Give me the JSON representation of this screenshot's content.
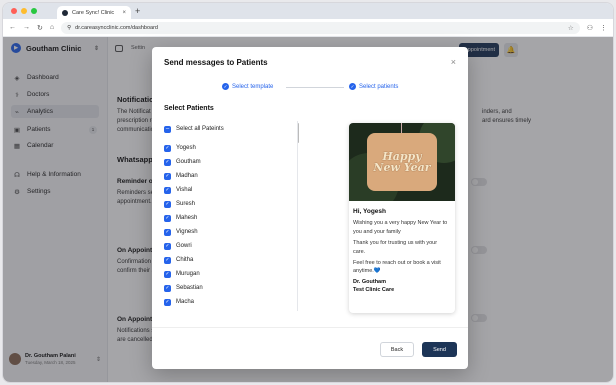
{
  "browser": {
    "tab_title": "Care Sync! Clinic",
    "url": "dr.careasyncclinic.com/dashboard",
    "close_glyph": "×",
    "new_tab_glyph": "+"
  },
  "sidebar": {
    "clinic_name": "Goutham Clinic",
    "items": [
      {
        "label": "Dashboard",
        "icon": "dashboard-icon"
      },
      {
        "label": "Doctors",
        "icon": "doctors-icon"
      },
      {
        "label": "Analytics",
        "icon": "analytics-icon"
      },
      {
        "label": "Patients",
        "icon": "patients-icon",
        "badge": "1"
      },
      {
        "label": "Calendar",
        "icon": "calendar-icon"
      },
      {
        "label": "Help & Information",
        "icon": "help-icon"
      },
      {
        "label": "Settings",
        "icon": "settings-icon"
      }
    ],
    "user": {
      "name": "Dr. Goutham Palani",
      "date": "Tuesday, March 18, 2025"
    }
  },
  "main": {
    "crumb": "Settin",
    "appointment_btn": "ppointment",
    "notifications_title": "Notification",
    "notifications_desc_1": "The Notificat",
    "notifications_desc_2": "prescription re",
    "notifications_desc_3": "communicatio",
    "right_desc_1": "inders, and",
    "right_desc_2": "ard ensures timely",
    "whatsapp_title": "Whatsapp",
    "reminder_title": "Reminder on",
    "reminder_desc_1": "Reminders se",
    "reminder_desc_2": "appointment.",
    "on_appt_1_title": "On Appointm",
    "on_appt_1_desc_1": "Confirmation",
    "on_appt_1_desc_2": "confirm their a",
    "on_appt_2_title": "On Appointm",
    "on_appt_2_desc_1": "Notifications s",
    "on_appt_2_desc_2": "are cancelled."
  },
  "modal": {
    "title": "Send messages to Patients",
    "close": "×",
    "steps": [
      "Select template",
      "Select patients"
    ],
    "section_title": "Select Patients",
    "select_all": "Select all Pateints",
    "patients": [
      "Yogesh",
      "Goutham",
      "Madhan",
      "Vishal",
      "Suresh",
      "Mahesh",
      "Vignesh",
      "Gowri",
      "Chitha",
      "Murugan",
      "Sebastian",
      "Macha"
    ],
    "preview": {
      "image_text_1": "Happy",
      "image_text_2": "New Year",
      "greeting": "Hi, Yogesh",
      "line1": "Wishing you a very happy New Year to you and your family",
      "line2": "Thank you for trusting us with your care.",
      "line3": "Feel free to reach out or book a visit anytime.",
      "heart": "💙",
      "sig_name": "Dr. Goutham",
      "sig_clinic": "Test Clinic Care"
    },
    "back_label": "Back",
    "send_label": "Send"
  },
  "colors": {
    "accent": "#2563eb",
    "primary_dark": "#1d3557"
  }
}
